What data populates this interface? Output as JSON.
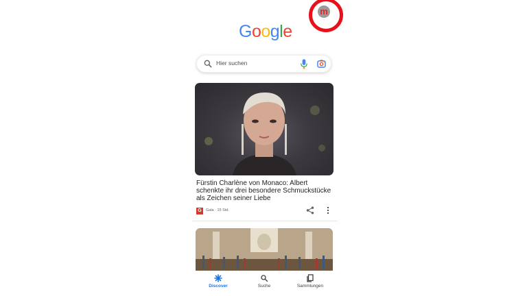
{
  "header": {
    "logo_letters": [
      "G",
      "o",
      "o",
      "g",
      "l",
      "e"
    ],
    "logo_colors": [
      "#4285F4",
      "#EA4335",
      "#FBBC05",
      "#4285F4",
      "#34A853",
      "#EA4335"
    ],
    "avatar_letter": "m",
    "avatar_highlight_color": "#e8101a"
  },
  "search": {
    "placeholder": "Hier suchen",
    "icons": [
      "search-icon",
      "mic-icon",
      "lens-icon"
    ]
  },
  "feed": [
    {
      "headline": "Fürstin Charlène von Monaco: Albert schenkte ihr drei besondere Schmuckstücke als Zeichen seiner Liebe",
      "source_logo": "G",
      "source": "Gala · 15 Std.",
      "image": "portrait photo"
    },
    {
      "image": "ornate hall painting"
    }
  ],
  "bottom_nav": {
    "items": [
      {
        "label": "Discover",
        "icon": "asterisk-icon",
        "active": true,
        "color": "#1a73e8"
      },
      {
        "label": "Suche",
        "icon": "search-icon",
        "active": false,
        "color": "#3c4043"
      },
      {
        "label": "Sammlungen",
        "icon": "collections-icon",
        "active": false,
        "color": "#3c4043"
      }
    ]
  }
}
